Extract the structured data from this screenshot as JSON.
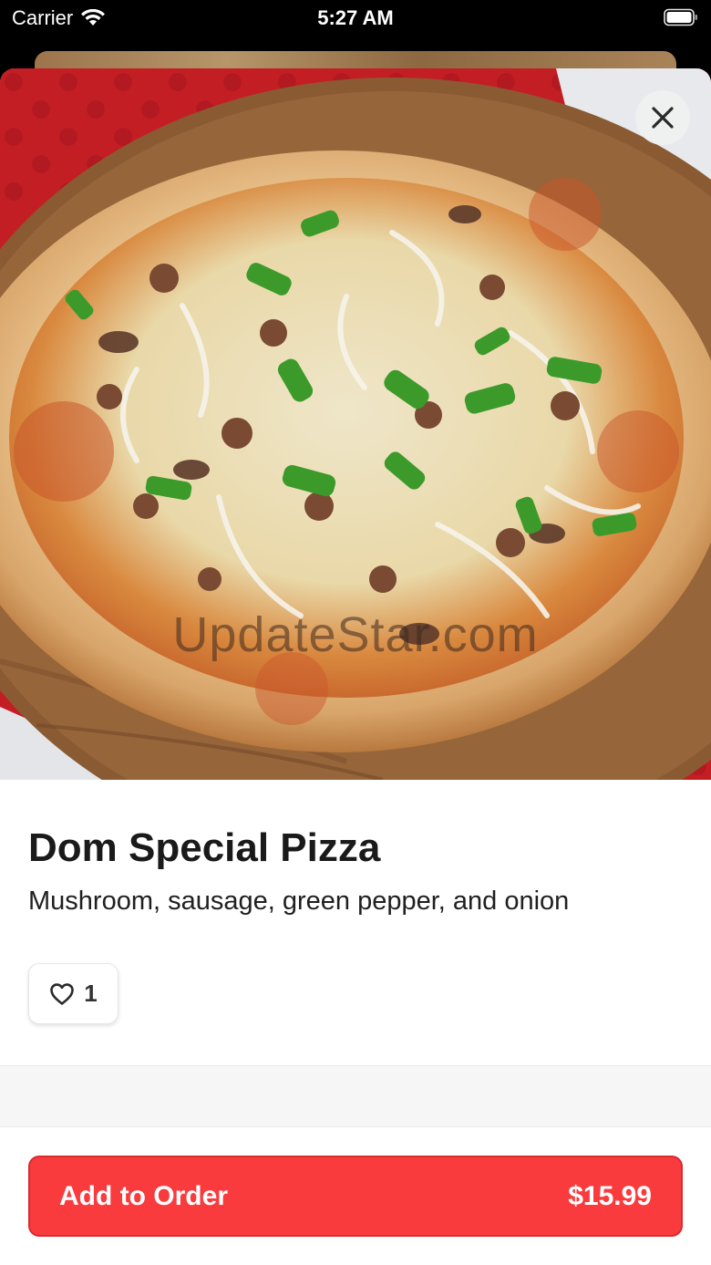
{
  "status_bar": {
    "carrier": "Carrier",
    "time": "5:27 AM"
  },
  "item": {
    "title": "Dom Special Pizza",
    "description": "Mushroom, sausage, green pepper, and onion",
    "likes": "1",
    "image_watermark": "UpdateStar.com"
  },
  "footer": {
    "add_label": "Add to Order",
    "price": "$15.99"
  },
  "colors": {
    "accent": "#f93b3e",
    "tablecloth": "#c41e25",
    "crust": "#d9ae7c",
    "board": "#8a5a32"
  },
  "icons": {
    "close": "close-icon",
    "like": "heart-icon",
    "wifi": "wifi-icon",
    "battery": "battery-icon"
  }
}
